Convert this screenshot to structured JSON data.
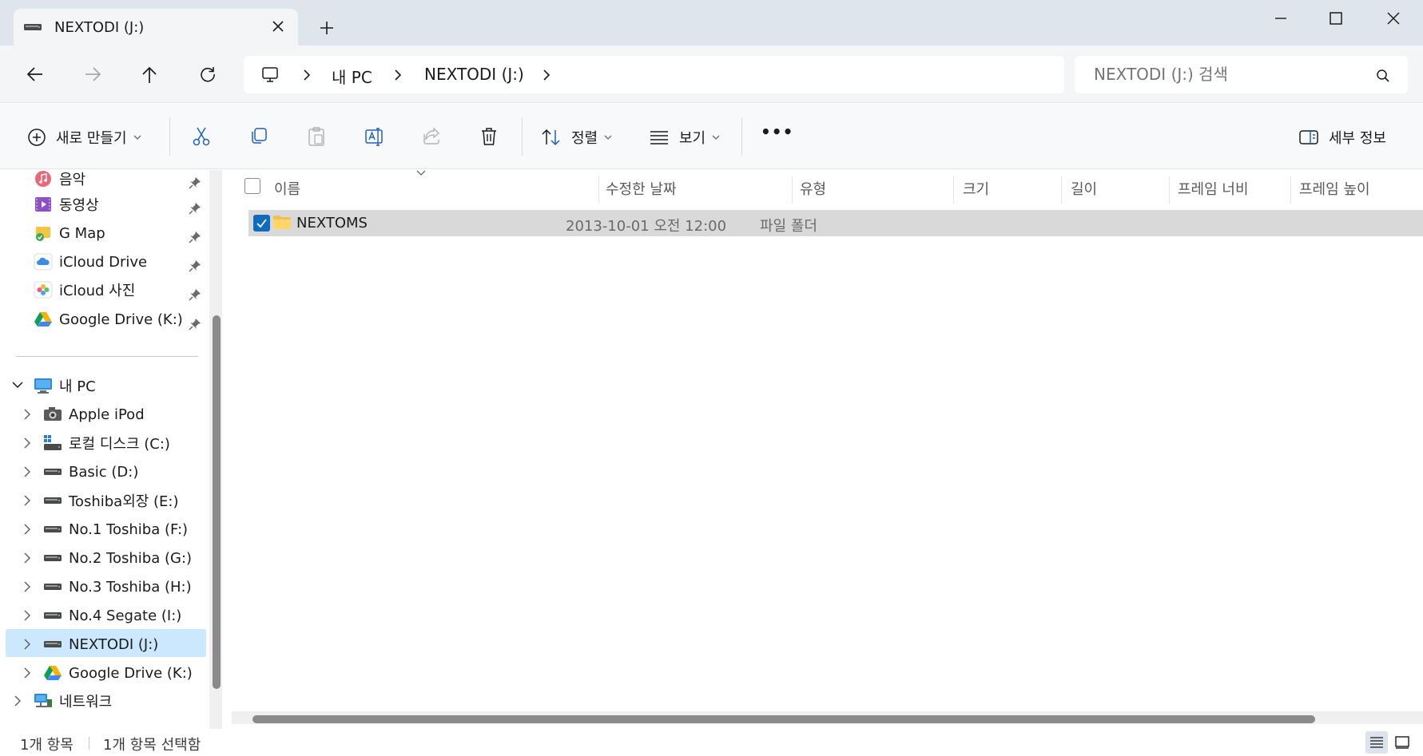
{
  "window": {
    "tab_title": "NEXTODI (J:)",
    "new_tab_symbol": "+"
  },
  "address": {
    "crumbs": [
      "내 PC",
      "NEXTODI (J:)"
    ]
  },
  "search": {
    "placeholder": "NEXTODI (J:) 검색"
  },
  "commands": {
    "new_label": "새로 만들기",
    "sort_label": "정렬",
    "view_label": "보기",
    "more_label": "•••",
    "details_label": "세부 정보"
  },
  "sidebar": {
    "quick_access": [
      {
        "label": "음악",
        "icon": "music-icon"
      },
      {
        "label": "동영상",
        "icon": "video-icon"
      },
      {
        "label": "G Map",
        "icon": "map-icon"
      },
      {
        "label": "iCloud Drive",
        "icon": "icloud-icon"
      },
      {
        "label": "iCloud 사진",
        "icon": "photos-icon"
      },
      {
        "label": "Google Drive (K:)",
        "icon": "google-drive-icon"
      }
    ],
    "this_pc": "내 PC",
    "drives": [
      {
        "label": "Apple iPod",
        "icon": "camera-icon"
      },
      {
        "label": "로컬 디스크 (C:)",
        "icon": "windows-drive-icon"
      },
      {
        "label": "Basic (D:)",
        "icon": "drive-icon"
      },
      {
        "label": "Toshiba외장 (E:)",
        "icon": "drive-icon"
      },
      {
        "label": "No.1 Toshiba (F:)",
        "icon": "drive-icon"
      },
      {
        "label": "No.2 Toshiba (G:)",
        "icon": "drive-icon"
      },
      {
        "label": "No.3 Toshiba (H:)",
        "icon": "drive-icon"
      },
      {
        "label": "No.4 Segate (I:)",
        "icon": "drive-icon"
      },
      {
        "label": "NEXTODI (J:)",
        "icon": "drive-icon"
      },
      {
        "label": "Google Drive (K:)",
        "icon": "google-drive-icon"
      }
    ],
    "network": "네트워크"
  },
  "columns": [
    "이름",
    "수정한 날짜",
    "유형",
    "크기",
    "길이",
    "프레임 너비",
    "프레임 높이"
  ],
  "files": [
    {
      "name": "NEXTOMS",
      "modified": "2013-10-01 오전 12:00",
      "type": "파일 폴더",
      "size": "",
      "length": "",
      "frame_width": "",
      "frame_height": ""
    }
  ],
  "status": {
    "item_count": "1개 항목",
    "selected_count": "1개 항목 선택함"
  },
  "colors": {
    "accent": "#0f6cbd",
    "selection": "#cce8ff",
    "row_selected": "#d9d9d9"
  }
}
